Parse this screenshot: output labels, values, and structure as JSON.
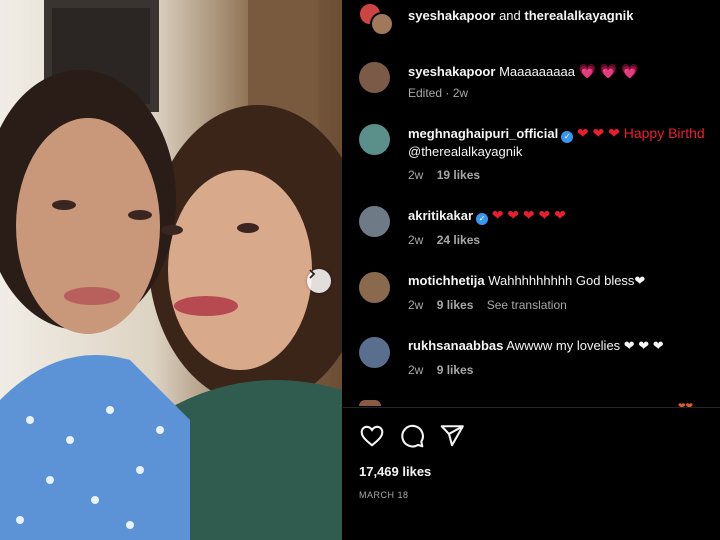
{
  "header": {
    "user1": "syeshakapoor",
    "conjunction": "and",
    "user2": "therealalkayagnik"
  },
  "comments": [
    {
      "username": "syeshakapoor",
      "text": "Maaaaaaaaa",
      "hearts": "💗 💗 💗",
      "time": "Edited · 2w",
      "likes": "",
      "extra": ""
    },
    {
      "username": "meghnaghaipuri_official",
      "verified": true,
      "text": "❤ ❤ ❤ Happy Birthd",
      "line2": "@therealalkayagnik",
      "time": "2w",
      "likes": "19 likes",
      "extra": ""
    },
    {
      "username": "akritikakar",
      "verified": true,
      "text": "❤ ❤ ❤ ❤ ❤",
      "time": "2w",
      "likes": "24 likes",
      "extra": ""
    },
    {
      "username": "motichhetija",
      "text": "Wahhhhhhhhh God bless❤",
      "time": "2w",
      "likes": "9 likes",
      "extra": "See translation"
    },
    {
      "username": "rukhsanaabbas",
      "text": "Awwww my lovelies ❤ ❤ ❤",
      "time": "2w",
      "likes": "9 likes",
      "extra": ""
    }
  ],
  "post": {
    "likes": "17,469 likes",
    "date": "MARCH 18"
  },
  "icons": {
    "like": "heart-icon",
    "comment": "comment-icon",
    "share": "share-icon",
    "next": "chevron-right-icon"
  },
  "colors": {
    "background": "#000000",
    "heart": "#ed1c2e",
    "verified": "#3897f0",
    "meta": "#a8a8a8"
  }
}
